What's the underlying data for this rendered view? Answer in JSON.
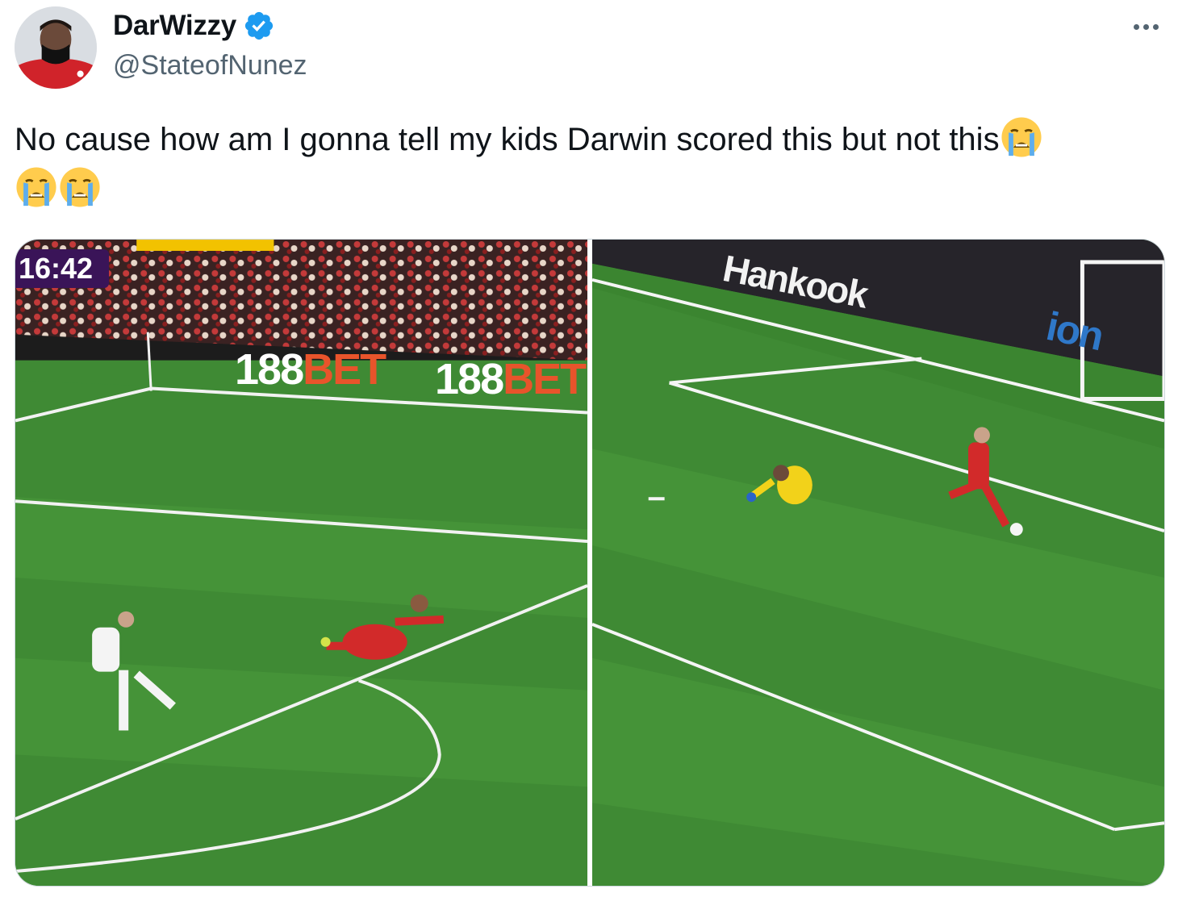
{
  "author": {
    "display_name": "DarWizzy",
    "handle": "@StateofNunez",
    "verified": true,
    "avatar_icon": "avatar-image"
  },
  "more_icon": "more-horizontal-icon",
  "tweet": {
    "text": "No cause how am I gonna tell my kids Darwin scored this but not this",
    "emojis": [
      "loudly-crying-face",
      "loudly-crying-face",
      "loudly-crying-face"
    ]
  },
  "media": {
    "left": {
      "clock": "16:42",
      "board_1": "188",
      "board_1_suffix": "BET",
      "board_2": "188",
      "board_2_suffix": "BET"
    },
    "right": {
      "board_1": "Hankook",
      "board_2": "ion"
    }
  },
  "colors": {
    "verified_blue": "#1d9bf0",
    "pitch_green": "#3f8a34",
    "text_primary": "#0f1419",
    "text_secondary": "#536471"
  }
}
